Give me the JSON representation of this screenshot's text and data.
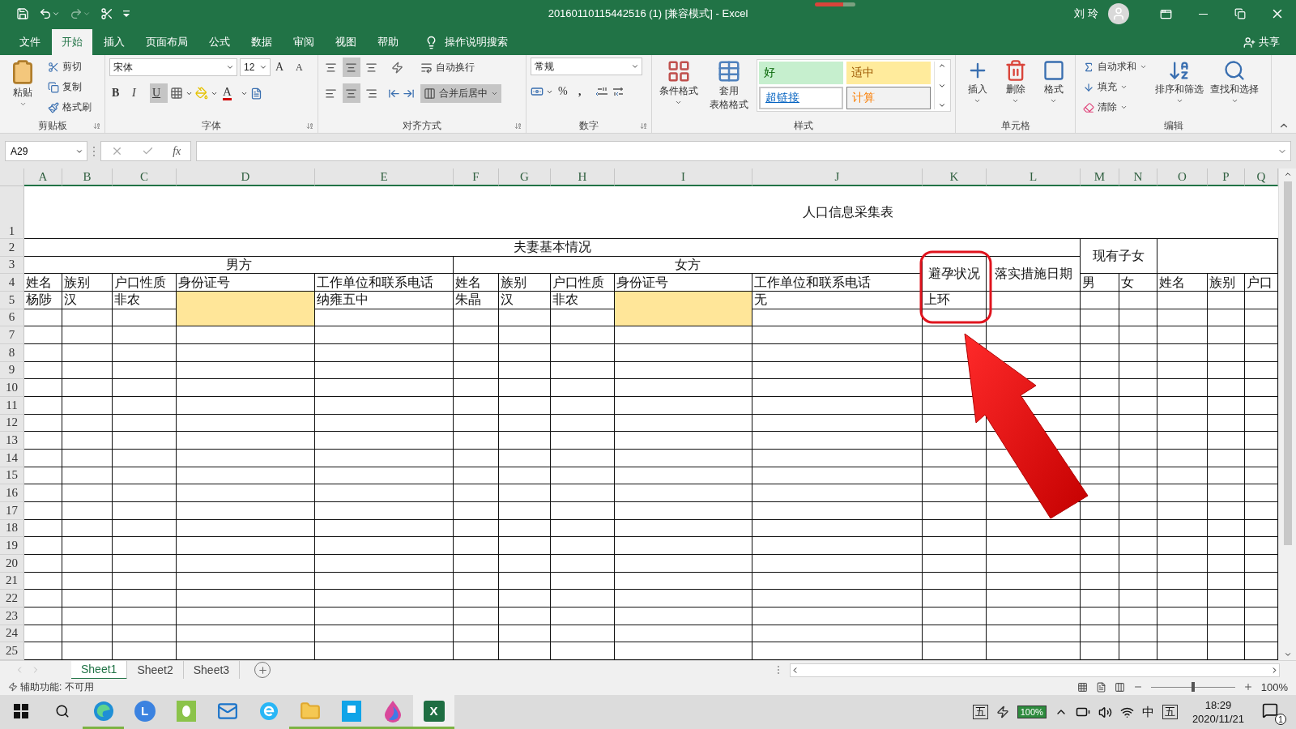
{
  "title_bar": {
    "title": "20160110115442516 (1) [兼容模式]  -  Excel",
    "user": "刘 玲"
  },
  "menu_tabs": [
    {
      "label": "文件",
      "selected": false
    },
    {
      "label": "开始",
      "selected": true
    },
    {
      "label": "插入",
      "selected": false
    },
    {
      "label": "页面布局",
      "selected": false
    },
    {
      "label": "公式",
      "selected": false
    },
    {
      "label": "数据",
      "selected": false
    },
    {
      "label": "审阅",
      "selected": false
    },
    {
      "label": "视图",
      "selected": false
    },
    {
      "label": "帮助",
      "selected": false
    }
  ],
  "tell_me": "操作说明搜索",
  "share": "共享",
  "ribbon": {
    "clipboard": {
      "label": "剪贴板",
      "paste": "粘贴",
      "items": [
        "剪切",
        "复制",
        "格式刷"
      ]
    },
    "font": {
      "label": "字体",
      "font_name": "宋体",
      "font_size": "12",
      "grow": "A",
      "shrink": "A",
      "styles": [
        {
          "label": "B",
          "selected": false
        },
        {
          "label": "I",
          "selected": false
        },
        {
          "label": "U",
          "selected": true
        }
      ],
      "font_color": "A"
    },
    "alignment": {
      "label": "对齐方式",
      "wrap": "自动换行",
      "merge": {
        "label": "合并后居中",
        "selected": true
      },
      "vertical": [
        {
          "selected": false
        },
        {
          "selected": true
        },
        {
          "selected": false
        }
      ],
      "horizontal": [
        {
          "selected": false
        },
        {
          "selected": true
        },
        {
          "selected": false
        }
      ]
    },
    "number": {
      "label": "数字",
      "format": "常规",
      "percent": "%",
      "comma": ","
    },
    "styles": {
      "label": "样式",
      "conditional": "条件格式",
      "table": [
        "套用",
        "表格格式"
      ],
      "cell_styles": [
        {
          "label": "好",
          "kind": "good"
        },
        {
          "label": "适中",
          "kind": "neutral"
        },
        {
          "label": "超链接",
          "kind": "link"
        },
        {
          "label": "计算",
          "kind": "calc"
        }
      ]
    },
    "cells": {
      "label": "单元格",
      "items": [
        "插入",
        "删除",
        "格式"
      ]
    },
    "editing": {
      "label": "编辑",
      "items": [
        "自动求和",
        "填充",
        "清除"
      ],
      "big": [
        "排序和筛选",
        "查找和选择"
      ]
    }
  },
  "formula_bar": {
    "name_box": "A29",
    "fx": "fx"
  },
  "sheet": {
    "columns": [
      "A",
      "B",
      "C",
      "D",
      "E",
      "F",
      "G",
      "H",
      "I",
      "J",
      "K",
      "L",
      "M",
      "N",
      "O",
      "P",
      "Q"
    ],
    "rows": [
      "1",
      "2",
      "3",
      "4",
      "5",
      "6",
      "7",
      "8",
      "9",
      "10",
      "11",
      "12",
      "13",
      "14",
      "15",
      "16",
      "17",
      "18",
      "19",
      "20",
      "21",
      "22",
      "23",
      "24",
      "25"
    ],
    "title": "人口信息采集表",
    "couple_header": "夫妻基本情况",
    "children_header": "现有子女",
    "male_header": "男方",
    "female_header": "女方",
    "contraception_header": "避孕状况",
    "date_header": "落实措施日期",
    "field_headers": [
      "姓名",
      "族别",
      "户口性质",
      "身份证号",
      "工作单位和联系电话",
      "姓名",
      "族别",
      "户口性质",
      "身份证号",
      "工作单位和联系电话",
      "男",
      "女",
      "姓名",
      "族别",
      "户口"
    ],
    "records": [
      [
        {
          "text": "杨陟",
          "highlighted": false
        },
        {
          "text": "汉",
          "highlighted": false
        },
        {
          "text": "非农",
          "highlighted": false
        },
        {
          "highlighted": true
        },
        {
          "text": "纳雍五中",
          "highlighted": false
        },
        {
          "text": "朱晶",
          "highlighted": false
        },
        {
          "text": "汉",
          "highlighted": false
        },
        {
          "text": "非农",
          "highlighted": false
        },
        {
          "highlighted": true
        },
        {
          "text": "无",
          "highlighted": false
        },
        {
          "text": "上环",
          "highlighted": false
        }
      ]
    ]
  },
  "sheet_tabs": [
    {
      "label": "Sheet1",
      "selected": true
    },
    {
      "label": "Sheet2",
      "selected": false
    },
    {
      "label": "Sheet3",
      "selected": false
    }
  ],
  "status_bar": {
    "accessibility": "辅助功能: 不可用",
    "zoom": "100%",
    "zoom_slider": {
      "level": 0.5
    }
  },
  "taskbar": {
    "apps": [
      {
        "kind": "browser",
        "running": true,
        "selected": false
      },
      {
        "kind": "letter",
        "label": "L",
        "running": false,
        "selected": false
      },
      {
        "kind": "chat",
        "running": false,
        "selected": false
      },
      {
        "kind": "mail",
        "running": false,
        "selected": false
      },
      {
        "kind": "ebrowser",
        "running": false,
        "selected": false
      },
      {
        "kind": "folder",
        "running": true,
        "selected": false
      },
      {
        "kind": "board",
        "running": true,
        "selected": false
      },
      {
        "kind": "paint",
        "running": true,
        "selected": false
      },
      {
        "kind": "excel",
        "label": "X",
        "running": true,
        "selected": true
      }
    ],
    "ime_mode": "五",
    "battery": "100%",
    "language": "中",
    "ime": "五",
    "time": "18:29",
    "date": "2020/11/21",
    "notifications": "1"
  }
}
